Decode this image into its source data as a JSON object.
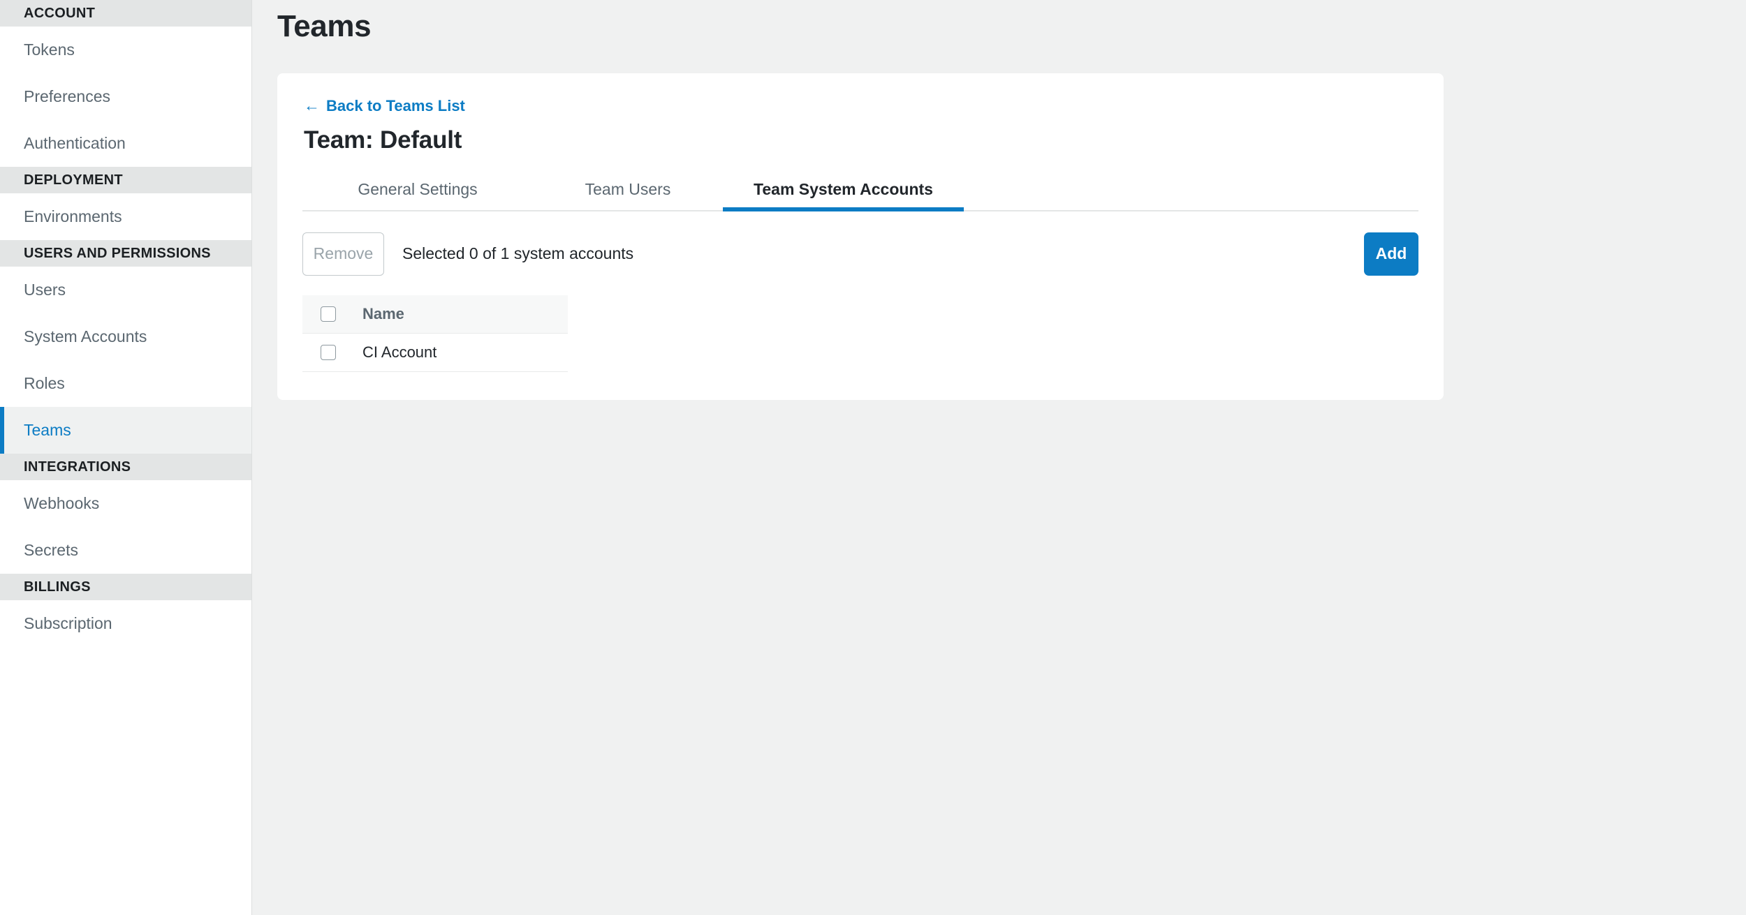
{
  "sidebar": {
    "sections": [
      {
        "label": "ACCOUNT",
        "items": [
          {
            "label": "Tokens",
            "active": false
          },
          {
            "label": "Preferences",
            "active": false
          },
          {
            "label": "Authentication",
            "active": false
          }
        ]
      },
      {
        "label": "DEPLOYMENT",
        "items": [
          {
            "label": "Environments",
            "active": false
          }
        ]
      },
      {
        "label": "USERS AND PERMISSIONS",
        "items": [
          {
            "label": "Users",
            "active": false
          },
          {
            "label": "System Accounts",
            "active": false
          },
          {
            "label": "Roles",
            "active": false
          },
          {
            "label": "Teams",
            "active": true
          }
        ]
      },
      {
        "label": "INTEGRATIONS",
        "items": [
          {
            "label": "Webhooks",
            "active": false
          },
          {
            "label": "Secrets",
            "active": false
          }
        ]
      },
      {
        "label": "BILLINGS",
        "items": [
          {
            "label": "Subscription",
            "active": false
          }
        ]
      }
    ]
  },
  "page": {
    "title": "Teams"
  },
  "card": {
    "back_link": {
      "arrow": "←",
      "label": "Back to Teams List"
    },
    "heading": "Team: Default",
    "tabs": [
      {
        "label": "General Settings",
        "active": false
      },
      {
        "label": "Team Users",
        "active": false
      },
      {
        "label": "Team System Accounts",
        "active": true
      }
    ],
    "toolbar": {
      "remove_label": "Remove",
      "selected_text": "Selected 0 of 1 system accounts",
      "add_label": "Add"
    },
    "table": {
      "columns": [
        "Name"
      ],
      "rows": [
        {
          "name": "CI Account",
          "checked": false
        }
      ],
      "header_checked": false
    }
  },
  "colors": {
    "accent": "#0c7cc4",
    "page_bg": "#f0f1f1",
    "card_bg": "#ffffff",
    "section_header_bg": "#e3e5e5",
    "muted_text": "#5b6770",
    "heading_text": "#21262b"
  },
  "icons": {
    "back_arrow": "arrow-left-icon",
    "checkbox": "checkbox-icon"
  }
}
